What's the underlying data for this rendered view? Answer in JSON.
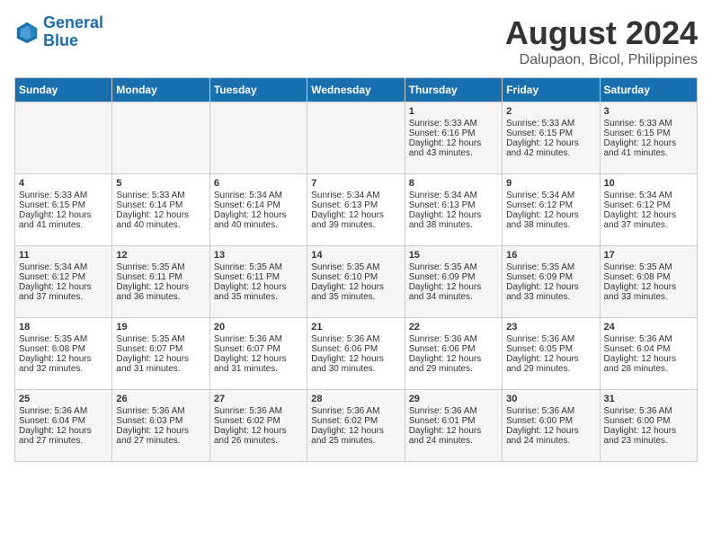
{
  "logo": {
    "line1": "General",
    "line2": "Blue"
  },
  "title": "August 2024",
  "subtitle": "Dalupaon, Bicol, Philippines",
  "weekdays": [
    "Sunday",
    "Monday",
    "Tuesday",
    "Wednesday",
    "Thursday",
    "Friday",
    "Saturday"
  ],
  "weeks": [
    [
      {
        "day": "",
        "sunrise": "",
        "sunset": "",
        "daylight": ""
      },
      {
        "day": "",
        "sunrise": "",
        "sunset": "",
        "daylight": ""
      },
      {
        "day": "",
        "sunrise": "",
        "sunset": "",
        "daylight": ""
      },
      {
        "day": "",
        "sunrise": "",
        "sunset": "",
        "daylight": ""
      },
      {
        "day": "1",
        "sunrise": "Sunrise: 5:33 AM",
        "sunset": "Sunset: 6:16 PM",
        "daylight": "Daylight: 12 hours and 43 minutes."
      },
      {
        "day": "2",
        "sunrise": "Sunrise: 5:33 AM",
        "sunset": "Sunset: 6:15 PM",
        "daylight": "Daylight: 12 hours and 42 minutes."
      },
      {
        "day": "3",
        "sunrise": "Sunrise: 5:33 AM",
        "sunset": "Sunset: 6:15 PM",
        "daylight": "Daylight: 12 hours and 41 minutes."
      }
    ],
    [
      {
        "day": "4",
        "sunrise": "Sunrise: 5:33 AM",
        "sunset": "Sunset: 6:15 PM",
        "daylight": "Daylight: 12 hours and 41 minutes."
      },
      {
        "day": "5",
        "sunrise": "Sunrise: 5:33 AM",
        "sunset": "Sunset: 6:14 PM",
        "daylight": "Daylight: 12 hours and 40 minutes."
      },
      {
        "day": "6",
        "sunrise": "Sunrise: 5:34 AM",
        "sunset": "Sunset: 6:14 PM",
        "daylight": "Daylight: 12 hours and 40 minutes."
      },
      {
        "day": "7",
        "sunrise": "Sunrise: 5:34 AM",
        "sunset": "Sunset: 6:13 PM",
        "daylight": "Daylight: 12 hours and 39 minutes."
      },
      {
        "day": "8",
        "sunrise": "Sunrise: 5:34 AM",
        "sunset": "Sunset: 6:13 PM",
        "daylight": "Daylight: 12 hours and 38 minutes."
      },
      {
        "day": "9",
        "sunrise": "Sunrise: 5:34 AM",
        "sunset": "Sunset: 6:12 PM",
        "daylight": "Daylight: 12 hours and 38 minutes."
      },
      {
        "day": "10",
        "sunrise": "Sunrise: 5:34 AM",
        "sunset": "Sunset: 6:12 PM",
        "daylight": "Daylight: 12 hours and 37 minutes."
      }
    ],
    [
      {
        "day": "11",
        "sunrise": "Sunrise: 5:34 AM",
        "sunset": "Sunset: 6:12 PM",
        "daylight": "Daylight: 12 hours and 37 minutes."
      },
      {
        "day": "12",
        "sunrise": "Sunrise: 5:35 AM",
        "sunset": "Sunset: 6:11 PM",
        "daylight": "Daylight: 12 hours and 36 minutes."
      },
      {
        "day": "13",
        "sunrise": "Sunrise: 5:35 AM",
        "sunset": "Sunset: 6:11 PM",
        "daylight": "Daylight: 12 hours and 35 minutes."
      },
      {
        "day": "14",
        "sunrise": "Sunrise: 5:35 AM",
        "sunset": "Sunset: 6:10 PM",
        "daylight": "Daylight: 12 hours and 35 minutes."
      },
      {
        "day": "15",
        "sunrise": "Sunrise: 5:35 AM",
        "sunset": "Sunset: 6:09 PM",
        "daylight": "Daylight: 12 hours and 34 minutes."
      },
      {
        "day": "16",
        "sunrise": "Sunrise: 5:35 AM",
        "sunset": "Sunset: 6:09 PM",
        "daylight": "Daylight: 12 hours and 33 minutes."
      },
      {
        "day": "17",
        "sunrise": "Sunrise: 5:35 AM",
        "sunset": "Sunset: 6:08 PM",
        "daylight": "Daylight: 12 hours and 33 minutes."
      }
    ],
    [
      {
        "day": "18",
        "sunrise": "Sunrise: 5:35 AM",
        "sunset": "Sunset: 6:08 PM",
        "daylight": "Daylight: 12 hours and 32 minutes."
      },
      {
        "day": "19",
        "sunrise": "Sunrise: 5:35 AM",
        "sunset": "Sunset: 6:07 PM",
        "daylight": "Daylight: 12 hours and 31 minutes."
      },
      {
        "day": "20",
        "sunrise": "Sunrise: 5:36 AM",
        "sunset": "Sunset: 6:07 PM",
        "daylight": "Daylight: 12 hours and 31 minutes."
      },
      {
        "day": "21",
        "sunrise": "Sunrise: 5:36 AM",
        "sunset": "Sunset: 6:06 PM",
        "daylight": "Daylight: 12 hours and 30 minutes."
      },
      {
        "day": "22",
        "sunrise": "Sunrise: 5:36 AM",
        "sunset": "Sunset: 6:06 PM",
        "daylight": "Daylight: 12 hours and 29 minutes."
      },
      {
        "day": "23",
        "sunrise": "Sunrise: 5:36 AM",
        "sunset": "Sunset: 6:05 PM",
        "daylight": "Daylight: 12 hours and 29 minutes."
      },
      {
        "day": "24",
        "sunrise": "Sunrise: 5:36 AM",
        "sunset": "Sunset: 6:04 PM",
        "daylight": "Daylight: 12 hours and 28 minutes."
      }
    ],
    [
      {
        "day": "25",
        "sunrise": "Sunrise: 5:36 AM",
        "sunset": "Sunset: 6:04 PM",
        "daylight": "Daylight: 12 hours and 27 minutes."
      },
      {
        "day": "26",
        "sunrise": "Sunrise: 5:36 AM",
        "sunset": "Sunset: 6:03 PM",
        "daylight": "Daylight: 12 hours and 27 minutes."
      },
      {
        "day": "27",
        "sunrise": "Sunrise: 5:36 AM",
        "sunset": "Sunset: 6:02 PM",
        "daylight": "Daylight: 12 hours and 26 minutes."
      },
      {
        "day": "28",
        "sunrise": "Sunrise: 5:36 AM",
        "sunset": "Sunset: 6:02 PM",
        "daylight": "Daylight: 12 hours and 25 minutes."
      },
      {
        "day": "29",
        "sunrise": "Sunrise: 5:36 AM",
        "sunset": "Sunset: 6:01 PM",
        "daylight": "Daylight: 12 hours and 24 minutes."
      },
      {
        "day": "30",
        "sunrise": "Sunrise: 5:36 AM",
        "sunset": "Sunset: 6:00 PM",
        "daylight": "Daylight: 12 hours and 24 minutes."
      },
      {
        "day": "31",
        "sunrise": "Sunrise: 5:36 AM",
        "sunset": "Sunset: 6:00 PM",
        "daylight": "Daylight: 12 hours and 23 minutes."
      }
    ]
  ]
}
